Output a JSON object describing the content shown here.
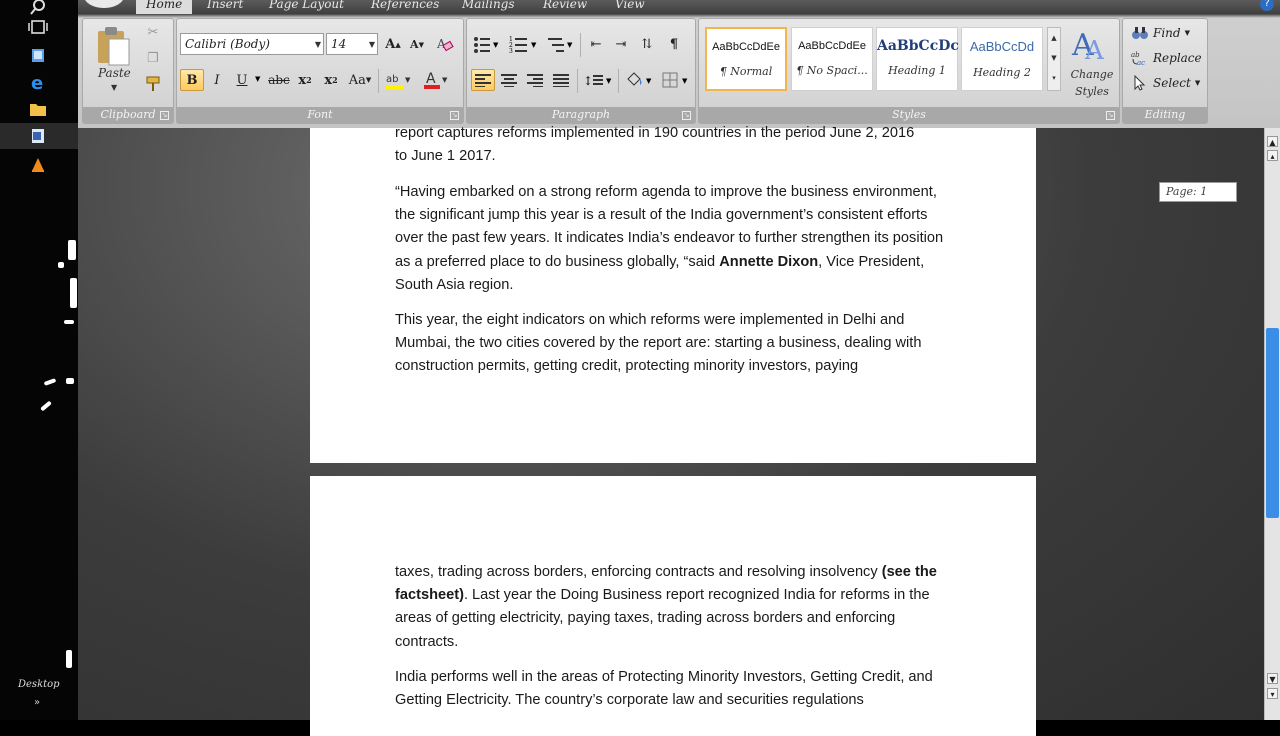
{
  "taskbar": {
    "desktop_label": "Desktop"
  },
  "ribbon": {
    "tabs": [
      "Home",
      "Insert",
      "Page Layout",
      "References",
      "Mailings",
      "Review",
      "View"
    ],
    "clipboard": {
      "label": "Clipboard",
      "paste_label": "Paste"
    },
    "font": {
      "label": "Font",
      "font_name": "Calibri (Body)",
      "font_size": "14"
    },
    "paragraph": {
      "label": "Paragraph"
    },
    "styles": {
      "label": "Styles",
      "items": [
        {
          "sample": "AaBbCcDdEe",
          "name": "¶ Normal"
        },
        {
          "sample": "AaBbCcDdEe",
          "name": "¶ No Spaci..."
        },
        {
          "sample": "AaBbCcDc",
          "name": "Heading 1"
        },
        {
          "sample": "AaBbCcDd",
          "name": "Heading 2"
        }
      ],
      "change_styles": "Change Styles"
    },
    "editing": {
      "label": "Editing",
      "find": "Find",
      "replace": "Replace",
      "select": "Select"
    }
  },
  "document": {
    "page_indicator": "Page: 1",
    "p1_line0": "report captures reforms implemented in 190 countries in the period June 2, 2016",
    "p1_line1": "to June 1 2017.",
    "p2_text": "“Having embarked on a strong reform agenda to improve the business environment, the significant jump this year is a result of the India government’s consistent efforts over the past few years. It indicates India’s endeavor to further strengthen its position as a preferred place to do business globally, “said ",
    "p2_bold": "Annette Dixon",
    "p2_tail": ", Vice President, South Asia region.",
    "p3_text": "This year, the eight indicators on which reforms were implemented  in Delhi and Mumbai, the two cities covered by the report are: starting a business, dealing with construction permits, getting credit, protecting minority investors, paying",
    "p4_text": "taxes, trading across borders, enforcing contracts and resolving insolvency ",
    "p4_bold": "(see the factsheet)",
    "p4_tail": ". Last year the Doing Business  report recognized India for reforms in the areas of getting electricity, paying taxes,  trading across borders and enforcing contracts.",
    "p5_text": "India performs well in the areas of Protecting Minority Investors, Getting Credit, and Getting Electricity.  The country’s corporate law and securities regulations"
  }
}
